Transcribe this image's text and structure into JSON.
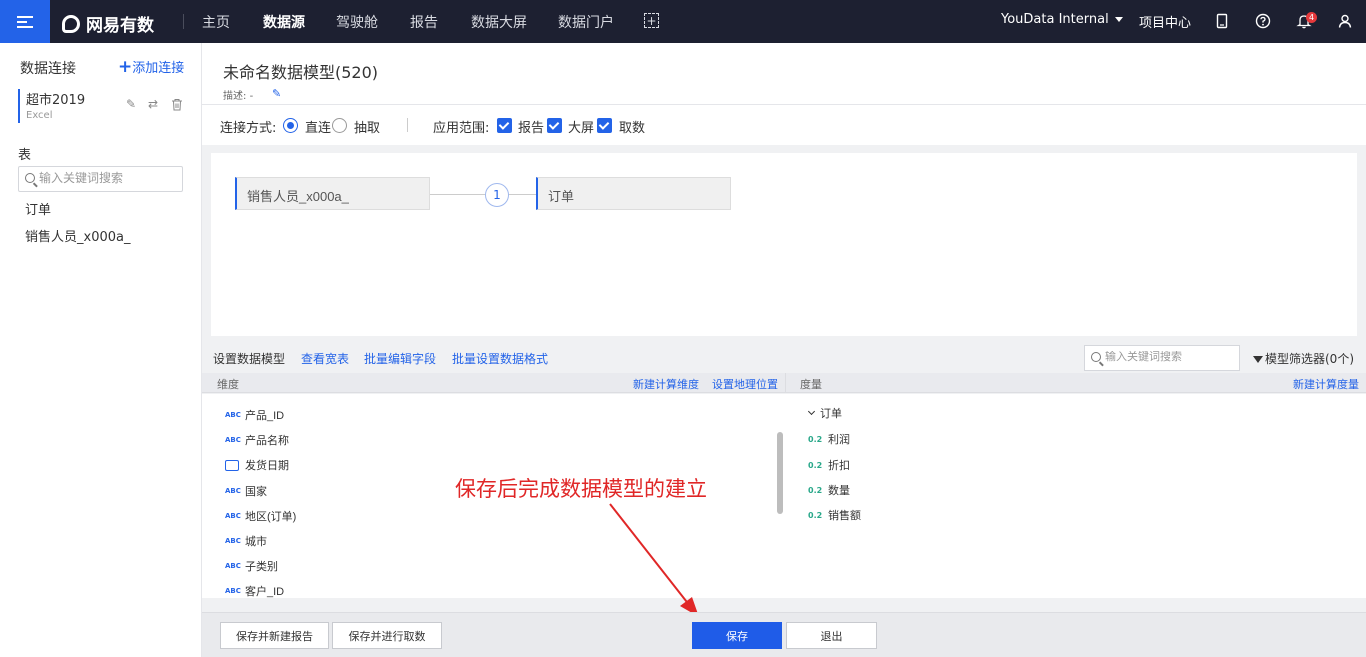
{
  "topbar": {
    "logo_text": "网易有数",
    "nav": [
      "主页",
      "数据源",
      "驾驶舱",
      "报告",
      "数据大屏",
      "数据门户"
    ],
    "active_nav": "数据源",
    "workspace": "YouData Internal",
    "project_center": "项目中心",
    "notification_count": "4"
  },
  "sidebar": {
    "title": "数据连接",
    "add_connection": "添加连接",
    "connection": {
      "name": "超市2019",
      "type": "Excel"
    },
    "tables_title": "表",
    "search_placeholder": "输入关键词搜索",
    "tables": [
      "订单",
      "销售人员_x000a_"
    ]
  },
  "model": {
    "title": "未命名数据模型(520)",
    "description_label": "描述:",
    "description_value": "-"
  },
  "options": {
    "connect_label": "连接方式:",
    "connect_modes": [
      "直连",
      "抽取"
    ],
    "selected_mode": "直连",
    "scope_label": "应用范围:",
    "scopes": [
      "报告",
      "大屏",
      "取数"
    ]
  },
  "canvas": {
    "left_table": "销售人员_x000a_",
    "right_table": "订单",
    "join_count": "1"
  },
  "field_toolbar": {
    "setup_label": "设置数据模型",
    "links": [
      "查看宽表",
      "批量编辑字段",
      "批量设置数据格式"
    ],
    "search_placeholder": "输入关键词搜索",
    "filter_label": "模型筛选器(0个)"
  },
  "dimensions": {
    "header": "维度",
    "new_calc": "新建计算维度",
    "geo": "设置地理位置",
    "fields": [
      {
        "type": "ABC",
        "name": "产品_ID"
      },
      {
        "type": "ABC",
        "name": "产品名称"
      },
      {
        "type": "date",
        "name": "发货日期"
      },
      {
        "type": "ABC",
        "name": "国家"
      },
      {
        "type": "ABC",
        "name": "地区(订单)"
      },
      {
        "type": "ABC",
        "name": "城市"
      },
      {
        "type": "ABC",
        "name": "子类别"
      },
      {
        "type": "ABC",
        "name": "客户_ID"
      }
    ]
  },
  "measures": {
    "header": "度量",
    "new_calc": "新建计算度量",
    "group": "订单",
    "type_label": "0.2",
    "fields": [
      "利润",
      "折扣",
      "数量",
      "销售额"
    ]
  },
  "annotation": "保存后完成数据模型的建立",
  "footer": {
    "save_new_report": "保存并新建报告",
    "save_fetch": "保存并进行取数",
    "save": "保存",
    "exit": "退出"
  },
  "colors": {
    "accent": "#2363e8",
    "topbar": "#1d2031",
    "annotation": "#e02727"
  }
}
